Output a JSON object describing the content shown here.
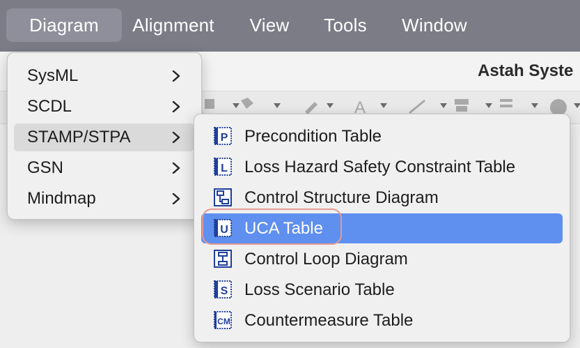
{
  "menubar": {
    "items": [
      {
        "label": "Diagram"
      },
      {
        "label": "Alignment"
      },
      {
        "label": "View"
      },
      {
        "label": "Tools"
      },
      {
        "label": "Window"
      }
    ]
  },
  "app": {
    "title": "Astah Syste"
  },
  "diagram_menu": {
    "items": [
      {
        "label": "SysML"
      },
      {
        "label": "SCDL"
      },
      {
        "label": "STAMP/STPA"
      },
      {
        "label": "GSN"
      },
      {
        "label": "Mindmap"
      }
    ]
  },
  "stamp_submenu": {
    "items": [
      {
        "label": "Precondition Table",
        "icon_letter": "P",
        "icon": "precondition-table-icon"
      },
      {
        "label": "Loss Hazard Safety Constraint Table",
        "icon_letter": "L",
        "icon": "loss-hazard-table-icon"
      },
      {
        "label": "Control Structure Diagram",
        "icon_letter": "",
        "icon": "control-structure-diagram-icon"
      },
      {
        "label": "UCA Table",
        "icon_letter": "U",
        "icon": "uca-table-icon"
      },
      {
        "label": "Control Loop Diagram",
        "icon_letter": "",
        "icon": "control-loop-diagram-icon"
      },
      {
        "label": "Loss Scenario Table",
        "icon_letter": "S",
        "icon": "loss-scenario-table-icon"
      },
      {
        "label": "Countermeasure Table",
        "icon_letter": "CM",
        "icon": "countermeasure-table-icon"
      }
    ]
  },
  "colors": {
    "menubar_bg": "#7c7c87",
    "selection": "#5f8fef",
    "highlight_ring": "#e59a90",
    "icon_blue": "#1f3f9a"
  }
}
